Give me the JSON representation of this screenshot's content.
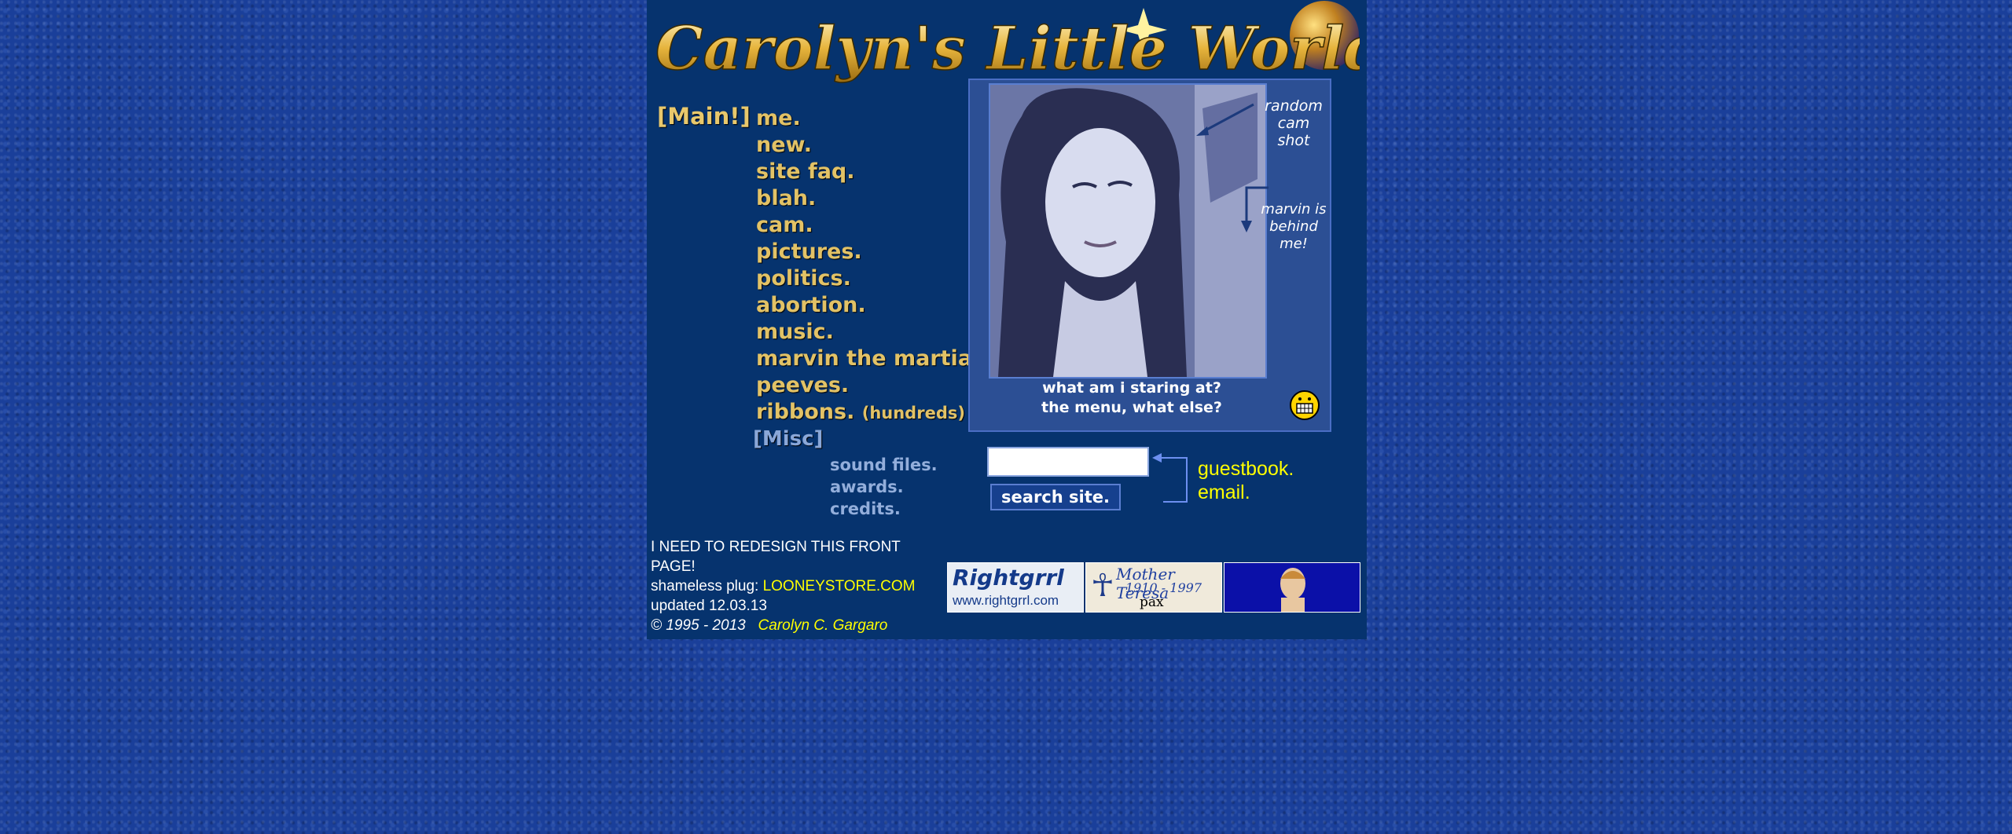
{
  "site": {
    "title": "Carolyn's Little World"
  },
  "menu": {
    "main_label": "[Main!]",
    "items": [
      {
        "label": "me."
      },
      {
        "label": "new."
      },
      {
        "label": "site faq."
      },
      {
        "label": "blah."
      },
      {
        "label": "cam."
      },
      {
        "label": "pictures."
      },
      {
        "label": "politics."
      },
      {
        "label": "abortion."
      },
      {
        "label": "music."
      },
      {
        "label": "marvin the martian."
      },
      {
        "label": "peeves."
      },
      {
        "label": "ribbons.",
        "note": "(hundreds)"
      }
    ],
    "misc_label": "[Misc]",
    "misc_items": [
      {
        "label": "sound files."
      },
      {
        "label": "awards."
      },
      {
        "label": "credits."
      }
    ]
  },
  "photo": {
    "caption_random": "random cam shot",
    "caption_marvin": "marvin is behind me!",
    "caption_stare_1": "what am i staring at?",
    "caption_stare_2": "the menu, what else?"
  },
  "search": {
    "placeholder": "",
    "button_label": "search site."
  },
  "links": {
    "guestbook": "guestbook.",
    "email": "email."
  },
  "footer": {
    "redesign": "I NEED TO REDESIGN THIS FRONT PAGE!",
    "plug_prefix": "shameless plug: ",
    "plug_link": "LOONEYSTORE.COM",
    "updated": "updated 12.03.13",
    "copyright": "© 1995 - 2013",
    "author": "Carolyn C. Gargaro"
  },
  "banners": {
    "rightgrrl_title": "Rightgrrl",
    "rightgrrl_url": "www.rightgrrl.com",
    "teresa_title": "Mother Teresa",
    "teresa_years": "1910 - 1997",
    "teresa_motto": "pax vobiscum"
  },
  "colors": {
    "background": "#1a3f9a",
    "panel": "#06336e",
    "menu_gold": "#e2c266",
    "link_yellow": "#ffff00"
  }
}
